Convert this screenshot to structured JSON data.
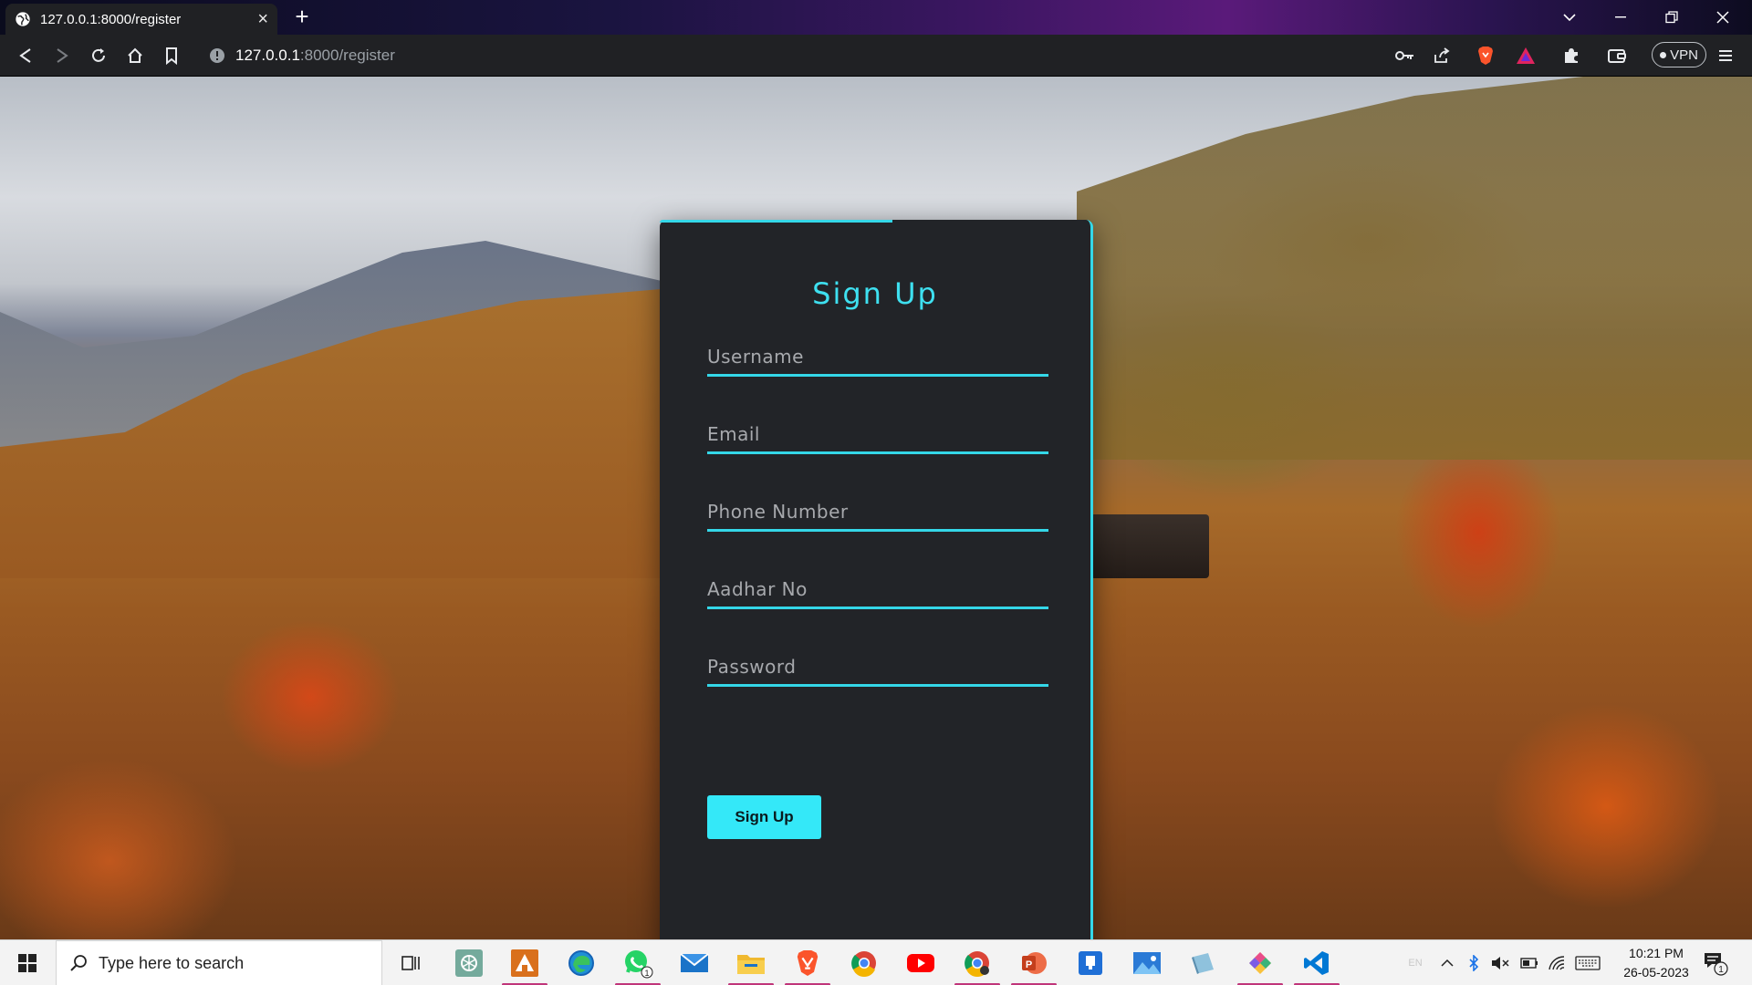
{
  "browser": {
    "tab_title": "127.0.0.1:8000/register",
    "url_host": "127.0.0.1",
    "url_path": ":8000/register",
    "vpn_label": "VPN"
  },
  "form": {
    "title": "Sign Up",
    "fields": [
      {
        "name": "username",
        "placeholder": "Username",
        "value": ""
      },
      {
        "name": "email",
        "placeholder": "Email",
        "value": ""
      },
      {
        "name": "phone",
        "placeholder": "Phone Number",
        "value": ""
      },
      {
        "name": "aadhar",
        "placeholder": "Aadhar No",
        "value": ""
      },
      {
        "name": "password",
        "placeholder": "Password",
        "value": ""
      }
    ],
    "submit_label": "Sign Up"
  },
  "colors": {
    "accent": "#34d7e8",
    "button": "#34e8f8",
    "card": "#222428"
  },
  "taskbar": {
    "search_placeholder": "Type here to search",
    "language": "EN",
    "time": "10:21 PM",
    "date": "26-05-2023",
    "notification_count": "1",
    "whatsapp_badge": "1",
    "apps": [
      "task-view-icon",
      "chatgpt-icon",
      "app-icon",
      "edge-icon",
      "whatsapp-icon",
      "mail-icon",
      "file-explorer-icon",
      "brave-icon",
      "chrome-icon",
      "youtube-icon",
      "chrome-profile-icon",
      "powerpoint-icon",
      "app-store-icon",
      "photos-icon",
      "app-icon",
      "paint-icon",
      "vscode-icon"
    ]
  }
}
